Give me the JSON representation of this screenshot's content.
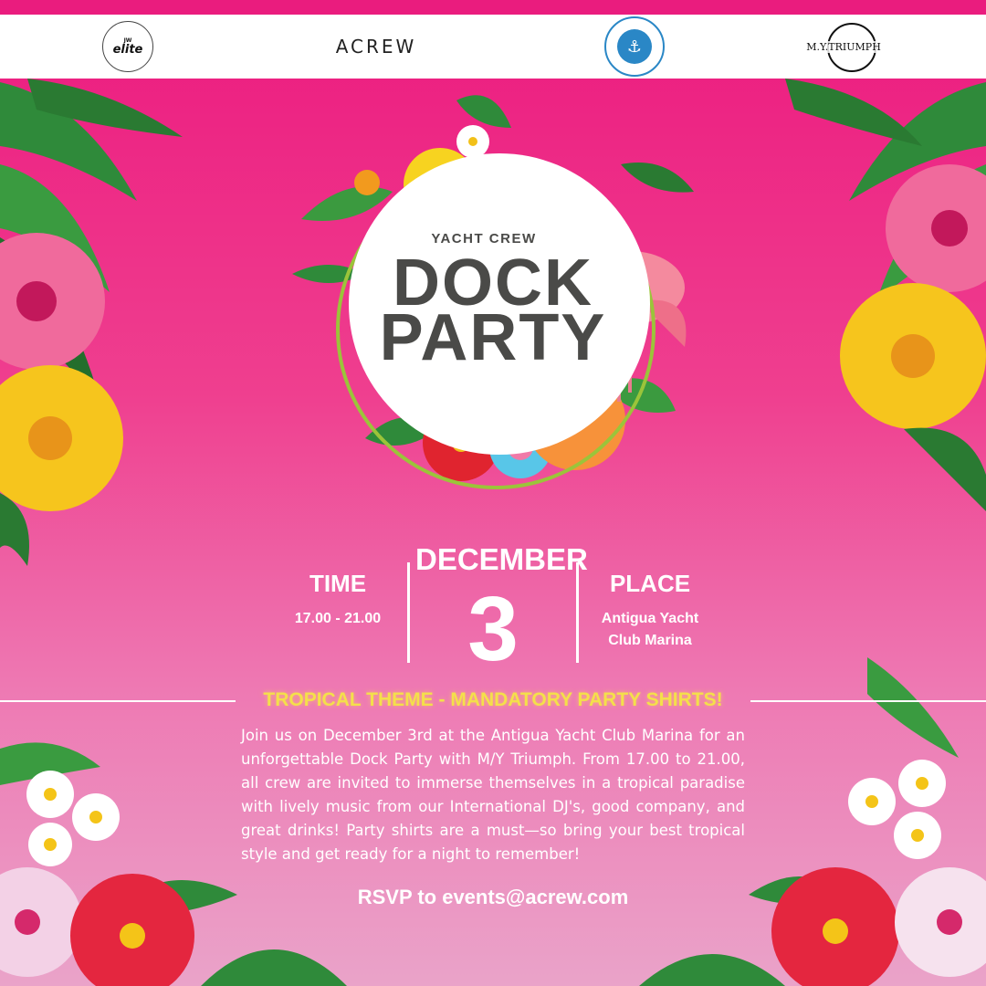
{
  "logos": {
    "elite_jw": "JW",
    "elite_word": "elite",
    "acrew": "ACREW",
    "triumph": "M.Y.TRIUMPH"
  },
  "hero": {
    "kicker": "YACHT CREW",
    "title_line1": "DOCK",
    "title_line2": "PARTY"
  },
  "details": {
    "time_label": "TIME",
    "time_value": "17.00 - 21.00",
    "month": "DECEMBER",
    "day": "3",
    "place_label": "PLACE",
    "place_value_line1": "Antigua Yacht",
    "place_value_line2": "Club Marina"
  },
  "theme_banner": "TROPICAL THEME - MANDATORY PARTY SHIRTS!",
  "description": "Join us on December 3rd at the Antigua Yacht Club Marina for an unforgettable Dock Party with M/Y Triumph. From 17.00 to 21.00, all crew are invited to immerse themselves in a tropical paradise with lively music from our International DJ's, good company, and great drinks! Party shirts are a must—so bring your best tropical style and get ready for a night to remember!",
  "rsvp": "RSVP to events@acrew.com",
  "colors": {
    "background_top": "#ec1b7f",
    "background_bottom": "#eaa3c9",
    "title_text": "#4a4a48",
    "theme_yellow": "#f4e04a",
    "ring_green": "#9bc43a"
  },
  "icons": {
    "acyc_logo": "anchor-icon",
    "triumph_logo": "globe-icon"
  }
}
